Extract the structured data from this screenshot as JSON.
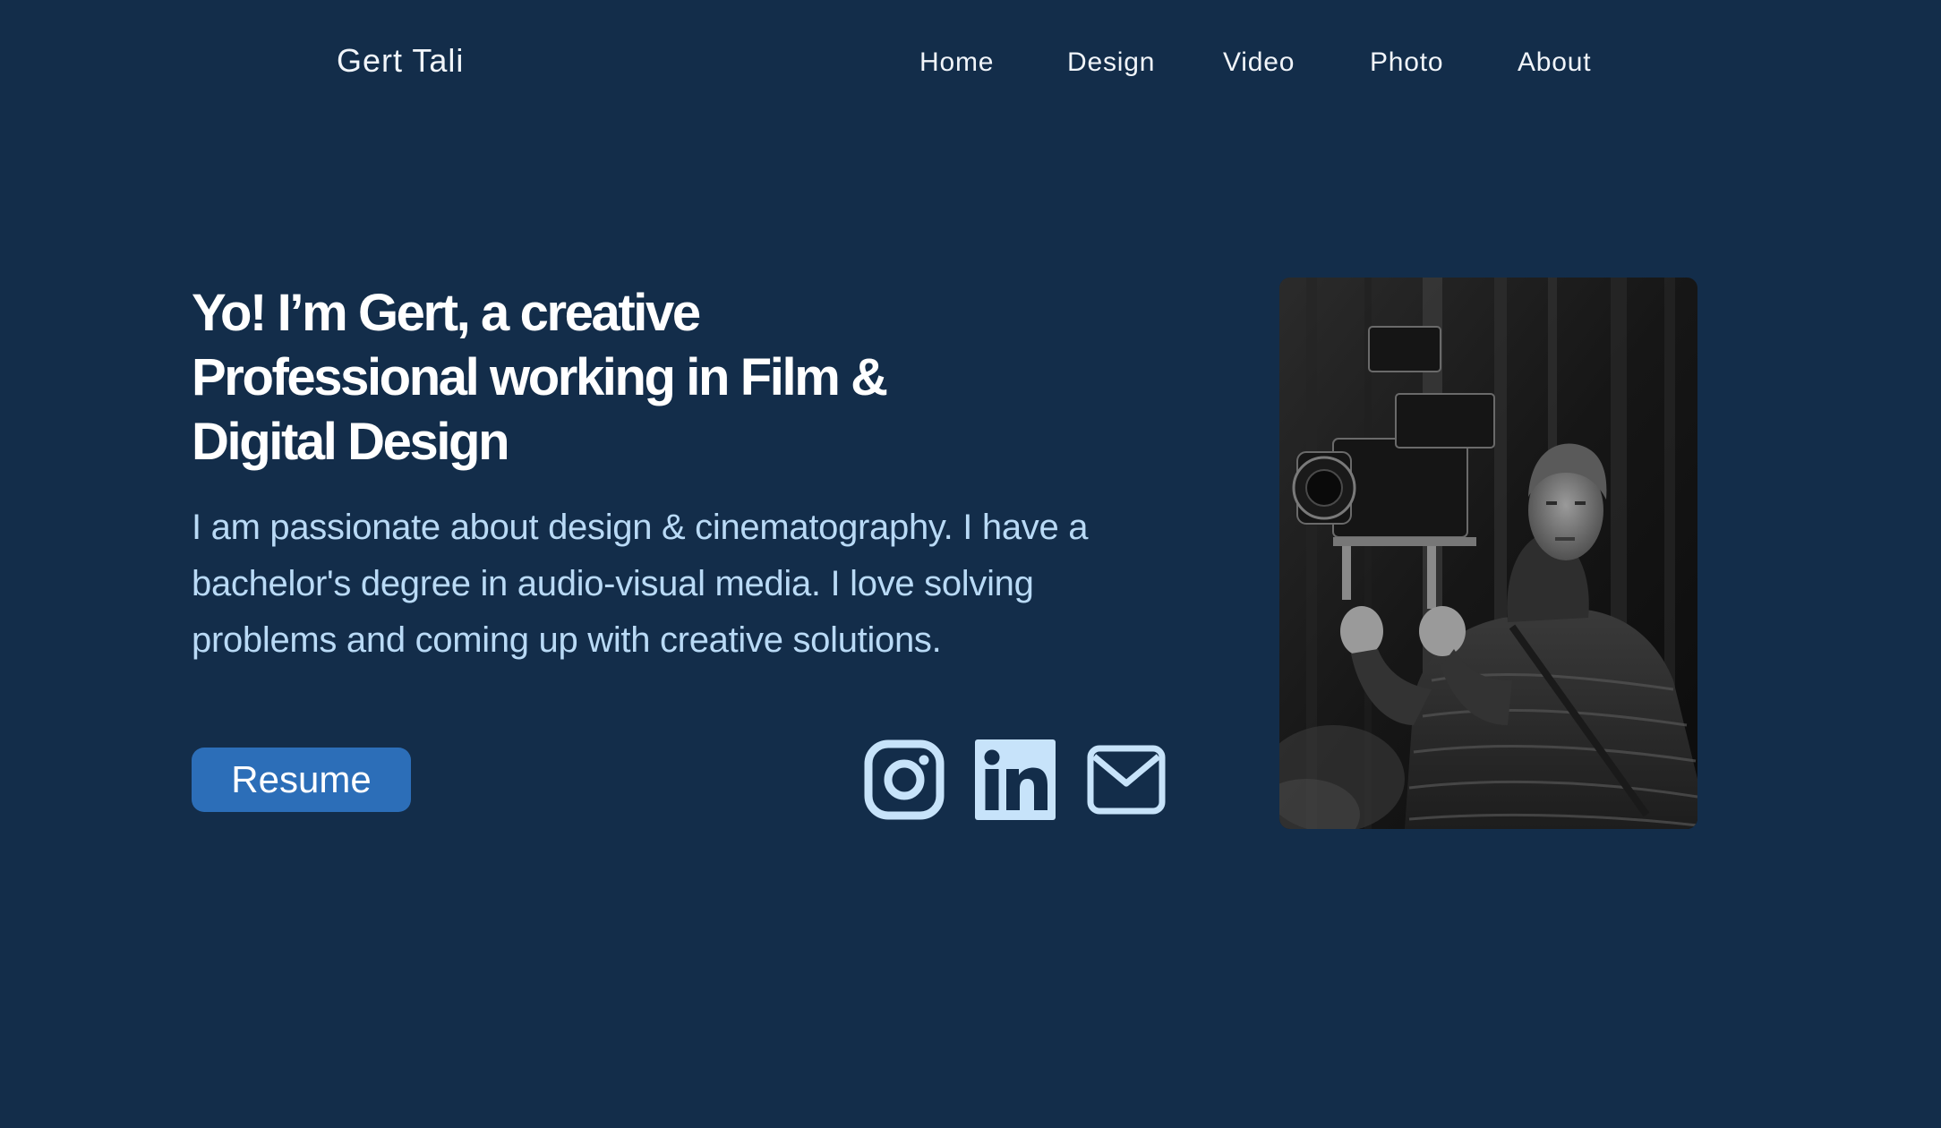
{
  "header": {
    "brand": "Gert Tali",
    "nav": [
      {
        "label": "Home"
      },
      {
        "label": "Design"
      },
      {
        "label": "Video"
      },
      {
        "label": "Photo"
      },
      {
        "label": "About"
      }
    ]
  },
  "hero": {
    "headline_line1": "Yo! I’m Gert, a creative",
    "headline_line2": "Professional working in Film &",
    "headline_line3": "Digital Design",
    "intro_line1": "I am passionate about design & cinematography. I have a",
    "intro_line2": "bachelor's degree in audio-visual media. I love solving",
    "intro_line3": "problems and coming up with creative solutions.",
    "resume_label": "Resume"
  },
  "social": {
    "icons": [
      "instagram-icon",
      "linkedin-icon",
      "mail-icon"
    ]
  },
  "portrait": {
    "description_icon": "portrait-photo"
  },
  "colors": {
    "background": "#132d4a",
    "accent": "#2c6eb8",
    "intro_text": "#b9daf6",
    "icon": "#c7e3fa"
  }
}
